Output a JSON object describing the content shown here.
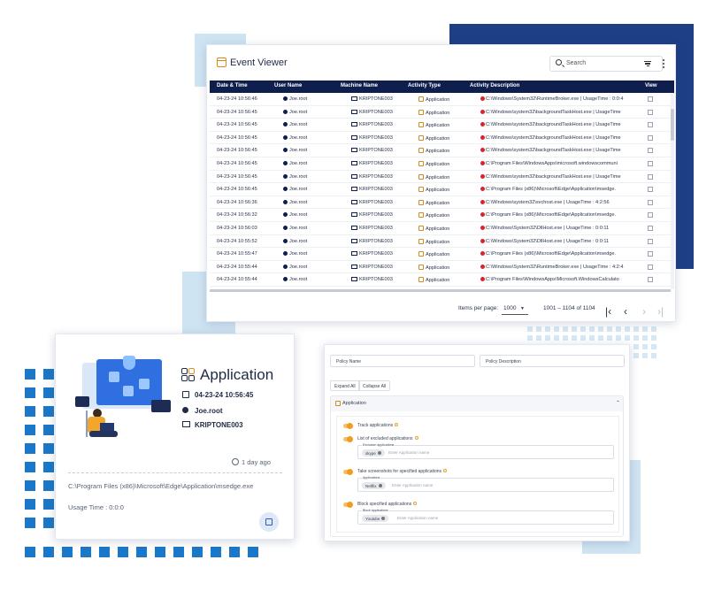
{
  "event_viewer": {
    "title": "Event Viewer",
    "search_placeholder": "Search",
    "columns": [
      "Date & Time",
      "User Name",
      "Machine Name",
      "Activity Type",
      "Activity Description",
      "View"
    ],
    "rows": [
      {
        "date": "04-23-24 10:56:46",
        "user": "Joe.root",
        "machine": "KRIPTONE003",
        "activity": "Application",
        "desc": "C:\\Windows\\System32\\RuntimeBroker.exe | UsageTime : 0:0:4"
      },
      {
        "date": "04-23-24 10:56:45",
        "user": "Joe.root",
        "machine": "KRIPTONE003",
        "activity": "Application",
        "desc": "C:\\Windows\\system32\\backgroundTaskHost.exe | UsageTime"
      },
      {
        "date": "04-23-24 10:56:45",
        "user": "Joe.root",
        "machine": "KRIPTONE003",
        "activity": "Application",
        "desc": "C:\\Windows\\system32\\backgroundTaskHost.exe | UsageTime"
      },
      {
        "date": "04-23-24 10:56:45",
        "user": "Joe.root",
        "machine": "KRIPTONE003",
        "activity": "Application",
        "desc": "C:\\Windows\\system32\\backgroundTaskHost.exe | UsageTime"
      },
      {
        "date": "04-23-24 10:56:45",
        "user": "Joe.root",
        "machine": "KRIPTONE003",
        "activity": "Application",
        "desc": "C:\\Windows\\system32\\backgroundTaskHost.exe | UsageTime"
      },
      {
        "date": "04-23-24 10:56:45",
        "user": "Joe.root",
        "machine": "KRIPTONE003",
        "activity": "Application",
        "desc": "C:\\Program Files\\WindowsApps\\microsoft.windowscommuni"
      },
      {
        "date": "04-23-24 10:56:45",
        "user": "Joe.root",
        "machine": "KRIPTONE003",
        "activity": "Application",
        "desc": "C:\\Windows\\system32\\backgroundTaskHost.exe | UsageTime"
      },
      {
        "date": "04-23-24 10:56:45",
        "user": "Joe.root",
        "machine": "KRIPTONE003",
        "activity": "Application",
        "desc": "C:\\Program Files (x86)\\Microsoft\\Edge\\Application\\msedge."
      },
      {
        "date": "04-23-24 10:56:36",
        "user": "Joe.root",
        "machine": "KRIPTONE003",
        "activity": "Application",
        "desc": "C:\\Windows\\system32\\svchost.exe | UsageTime : 4:2:56"
      },
      {
        "date": "04-23-24 10:56:32",
        "user": "Joe.root",
        "machine": "KRIPTONE003",
        "activity": "Application",
        "desc": "C:\\Program Files (x86)\\Microsoft\\Edge\\Application\\msedge."
      },
      {
        "date": "04-23-24 10:56:03",
        "user": "Joe.root",
        "machine": "KRIPTONE003",
        "activity": "Application",
        "desc": "C:\\Windows\\System32\\DllHost.exe | UsageTime : 0:0:11"
      },
      {
        "date": "04-23-24 10:55:52",
        "user": "Joe.root",
        "machine": "KRIPTONE003",
        "activity": "Application",
        "desc": "C:\\Windows\\System32\\DllHost.exe | UsageTime : 0:0:11"
      },
      {
        "date": "04-23-24 10:55:47",
        "user": "Joe.root",
        "machine": "KRIPTONE003",
        "activity": "Application",
        "desc": "C:\\Program Files (x86)\\Microsoft\\Edge\\Application\\msedge."
      },
      {
        "date": "04-23-24 10:55:44",
        "user": "Joe.root",
        "machine": "KRIPTONE003",
        "activity": "Application",
        "desc": "C:\\Windows\\System32\\RuntimeBroker.exe | UsageTime : 4:2:4"
      },
      {
        "date": "04-23-24 10:55:44",
        "user": "Joe.root",
        "machine": "KRIPTONE003",
        "activity": "Application",
        "desc": "C:\\Program Files\\WindowsApps\\Microsoft.WindowsCalculato"
      }
    ],
    "pager": {
      "items_per_page_label": "Items per page:",
      "items_per_page_value": "1000",
      "range": "1001 – 1104 of 1104",
      "first": "|<",
      "prev": "<",
      "next": ">",
      "last": ">|"
    }
  },
  "app_card": {
    "title": "Application",
    "datetime": "04-23-24 10:56:45",
    "user": "Joe.root",
    "machine": "KRIPTONE003",
    "ago": "1 day ago",
    "path": "C:\\Program Files (x86)\\Microsoft\\Edge\\Application\\msedge.exe",
    "usage": "Usage Time : 0:0:0"
  },
  "policy": {
    "policy_name_placeholder": "Policy Name",
    "policy_desc_placeholder": "Policy Description",
    "expand_all": "Expand All",
    "collapse_all": "Collapse All",
    "section_title": "Application",
    "track_label": "Track applications",
    "excluded_label": "List of excluded applications",
    "excluded_field_label": "Exclusion applications",
    "excluded_chip": "skype",
    "screenshot_label": "Take screenshots for specified applications",
    "screenshot_field_label": "Applications",
    "screenshot_chip": "Netflix",
    "block_label": "Block specified applications",
    "block_field_label": "Block applications",
    "block_chip": "Youtube",
    "app_name_placeholder": "Enter Application name"
  }
}
